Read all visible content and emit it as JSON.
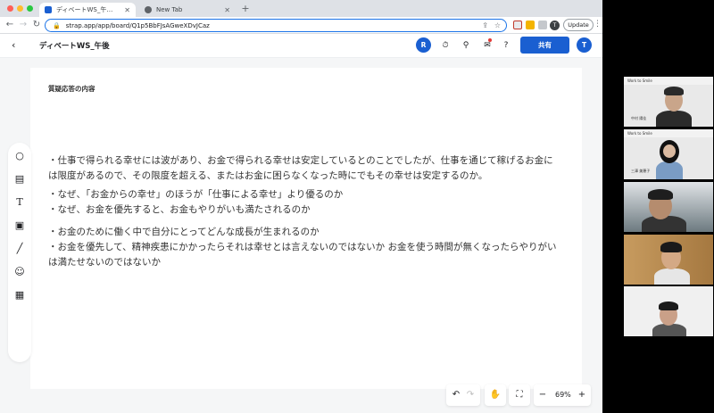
{
  "browser": {
    "tabs": [
      {
        "label": "ディベートWS_午後 - Strap",
        "active": true
      },
      {
        "label": "New Tab",
        "active": false
      }
    ],
    "url": "strap.app/app/board/Q1p5BbFJsAGweXDvJCaz",
    "profile_initial": "T",
    "update_label": "Update"
  },
  "app": {
    "board_title": "ディベートWS_午後",
    "avatars": [
      "R",
      "T"
    ],
    "share_label": "共有"
  },
  "board": {
    "heading": "質疑応答の内容",
    "lines": [
      "・仕事で得られる幸せには波があり、お金で得られる幸せは安定しているとのことでしたが、仕事を通じて稼げるお金に",
      "は限度があるので、その限度を超える、またはお金に困らなくなった時にでもその幸せは安定するのか。",
      "・なぜ、「お金からの幸せ」のほうが「仕事による幸せ」より優るのか",
      "・なぜ、お金を優先すると、お金もやりがいも満たされるのか",
      "・お金のために働く中で自分にとってどんな成長が生まれるのか",
      "・お金を優先して、精神疾患にかかったらそれは幸せとは言えないのではないか お金を使う時間が無くなったらやりがい",
      "は満たせないのではないか"
    ]
  },
  "zoom": {
    "level": "69%"
  },
  "video": {
    "slide_label": "Work to Smile",
    "names": [
      "中村 陽佳",
      "三澤 美穂子"
    ]
  },
  "colors": {
    "accent": "#1a5fd1",
    "notification": "#e53935"
  }
}
